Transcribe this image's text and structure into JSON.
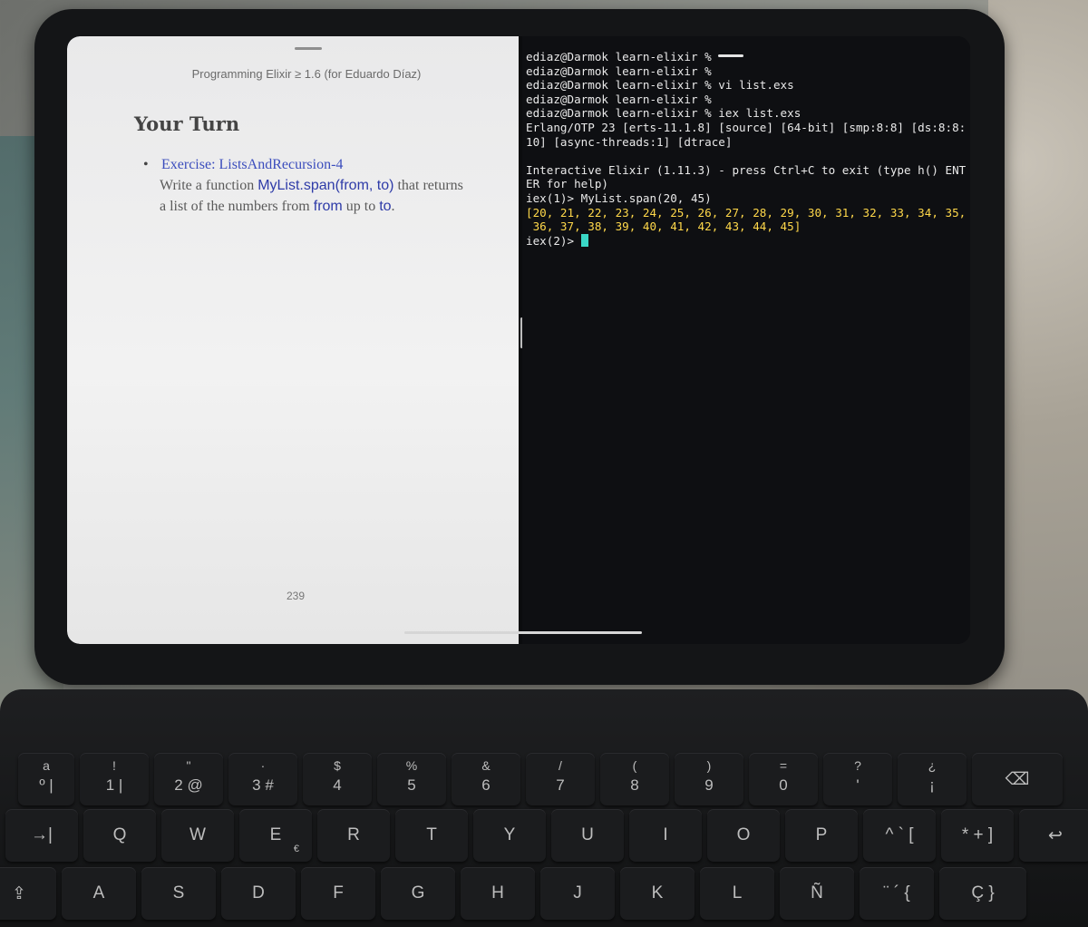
{
  "book": {
    "running_head": "Programming Elixir ≥ 1.6 (for Eduardo Díaz)",
    "heading": "Your Turn",
    "exercise_link": "Exercise: ListsAndRecursion-4",
    "text_1": "Write a function ",
    "code_1": "MyList.span(from, to)",
    "text_2": " that returns a list of the numbers from ",
    "code_2": "from",
    "text_3": " up to ",
    "code_3": "to",
    "text_4": ".",
    "page_number": "239"
  },
  "terminal": {
    "lines": [
      "ediaz@Darmok learn-elixir %",
      "ediaz@Darmok learn-elixir %",
      "ediaz@Darmok learn-elixir % vi list.exs",
      "ediaz@Darmok learn-elixir %",
      "ediaz@Darmok learn-elixir % iex list.exs",
      "Erlang/OTP 23 [erts-11.1.8] [source] [64-bit] [smp:8:8] [ds:8:8:",
      "10] [async-threads:1] [dtrace]",
      "",
      "Interactive Elixir (1.11.3) - press Ctrl+C to exit (type h() ENT",
      "ER for help)",
      "iex(1)> MyList.span(20, 45)"
    ],
    "result_lines": [
      "[20, 21, 22, 23, 24, 25, 26, 27, 28, 29, 30, 31, 32, 33, 34, 35,",
      " 36, 37, 38, 39, 40, 41, 42, 43, 44, 45]"
    ],
    "prompt": "iex(2)> "
  },
  "keyboard": {
    "row1": [
      {
        "top": "a",
        "main": "º |"
      },
      {
        "top": "!",
        "main": "1 |"
      },
      {
        "top": "\"",
        "main": "2 @"
      },
      {
        "top": "·",
        "main": "3 #"
      },
      {
        "top": "$",
        "main": "4"
      },
      {
        "top": "%",
        "main": "5"
      },
      {
        "top": "&",
        "main": "6"
      },
      {
        "top": "/",
        "main": "7"
      },
      {
        "top": "(",
        "main": "8"
      },
      {
        "top": ")",
        "main": "9"
      },
      {
        "top": "=",
        "main": "0"
      },
      {
        "top": "?",
        "main": "'"
      },
      {
        "top": "¿",
        "main": "¡"
      },
      {
        "top": "",
        "main": "⌫"
      }
    ],
    "row2": [
      {
        "main": "→|"
      },
      {
        "main": "Q"
      },
      {
        "main": "W"
      },
      {
        "main": "E",
        "sub": "€"
      },
      {
        "main": "R"
      },
      {
        "main": "T"
      },
      {
        "main": "Y"
      },
      {
        "main": "U"
      },
      {
        "main": "I"
      },
      {
        "main": "O"
      },
      {
        "main": "P"
      },
      {
        "main": "^ ` ["
      },
      {
        "main": "* + ]"
      },
      {
        "main": "↩"
      }
    ],
    "row3": [
      {
        "main": "⇪"
      },
      {
        "main": "A"
      },
      {
        "main": "S"
      },
      {
        "main": "D"
      },
      {
        "main": "F"
      },
      {
        "main": "G"
      },
      {
        "main": "H"
      },
      {
        "main": "J"
      },
      {
        "main": "K"
      },
      {
        "main": "L"
      },
      {
        "main": "Ñ"
      },
      {
        "main": "¨ ´ {"
      },
      {
        "main": "Ç }"
      }
    ]
  }
}
